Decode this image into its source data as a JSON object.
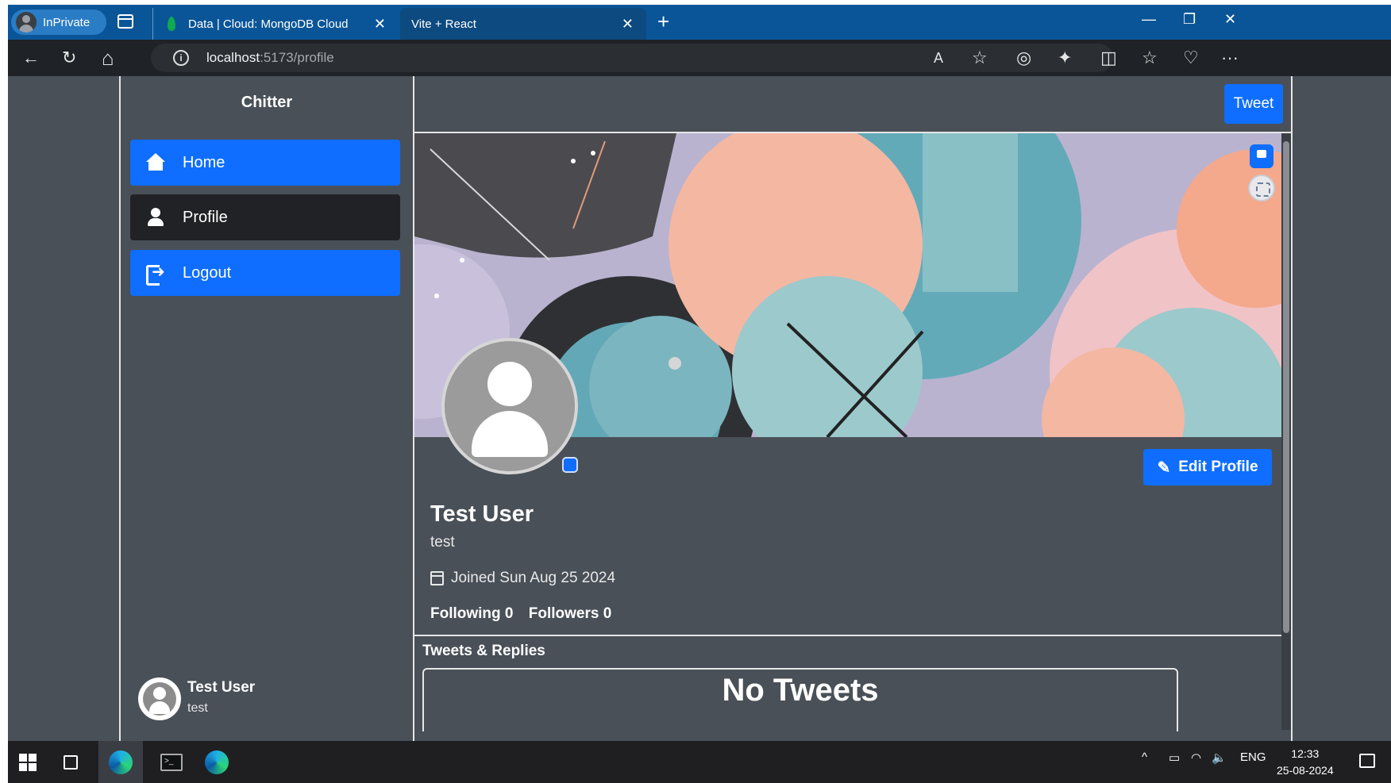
{
  "browser": {
    "inprivate_label": "InPrivate",
    "tabs": [
      {
        "title": "Data | Cloud: MongoDB Cloud",
        "close": "✕"
      },
      {
        "title": "Vite + React",
        "close": "✕"
      }
    ],
    "new_tab": "+",
    "window_controls": {
      "minimize": "—",
      "restore": "❐",
      "close": "✕"
    },
    "url": {
      "host": "localhost",
      "path": ":5173/profile"
    },
    "nav": {
      "back": "←",
      "refresh": "↻",
      "home": "⌂"
    },
    "toolbar_icons": {
      "read_aloud": "A",
      "favorite": "☆",
      "extension": "◎",
      "extensions": "✦",
      "split": "◫",
      "favorites": "☆",
      "health": "♡",
      "more": "···"
    }
  },
  "sidebar": {
    "brand": "Chitter",
    "items": [
      {
        "label": "Home",
        "icon": "home-icon"
      },
      {
        "label": "Profile",
        "icon": "user-icon"
      },
      {
        "label": "Logout",
        "icon": "logout-icon"
      }
    ],
    "account": {
      "name": "Test User",
      "handle": "test"
    }
  },
  "main": {
    "tweet_button": "Tweet",
    "edit_profile_button": "Edit Profile",
    "profile": {
      "name": "Test User",
      "handle": "test",
      "joined": "Joined Sun Aug 25 2024",
      "following": "Following 0",
      "followers": "Followers 0"
    },
    "section_title": "Tweets & Replies",
    "empty_state": "No Tweets"
  },
  "taskbar": {
    "tray": {
      "chevron": "^",
      "language": "ENG"
    },
    "clock": {
      "time": "12:33",
      "date": "25-08-2024"
    }
  },
  "colors": {
    "accent": "#0f6eff",
    "page_bg": "#4a5058",
    "active_nav": "#212225",
    "tabbar": "#0a5597"
  }
}
